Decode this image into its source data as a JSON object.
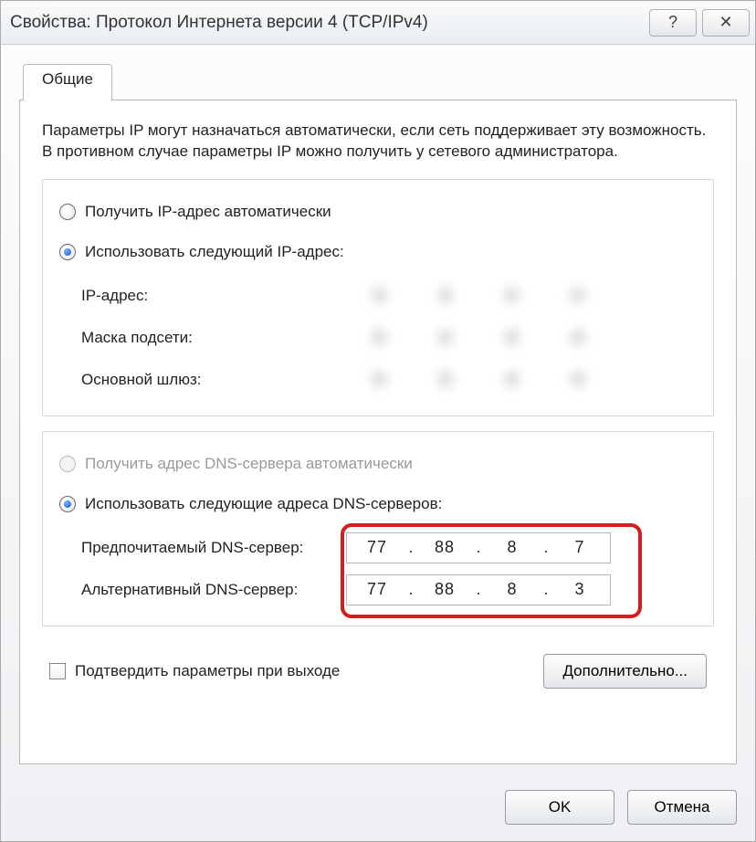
{
  "window": {
    "title": "Свойства: Протокол Интернета версии 4 (TCP/IPv4)"
  },
  "tabs": {
    "general": "Общие"
  },
  "description": "Параметры IP могут назначаться автоматически, если сеть поддерживает эту возможность. В противном случае параметры IP можно получить у сетевого администратора.",
  "ip_group": {
    "radio_auto": "Получить IP-адрес автоматически",
    "radio_manual": "Использовать следующий IP-адрес:",
    "field_ip": "IP-адрес:",
    "field_mask": "Маска подсети:",
    "field_gateway": "Основной шлюз:"
  },
  "dns_group": {
    "radio_auto": "Получить адрес DNS-сервера автоматически",
    "radio_manual": "Использовать следующие адреса DNS-серверов:",
    "field_preferred": "Предпочитаемый DNS-сервер:",
    "field_alternate": "Альтернативный DNS-сервер:",
    "preferred": {
      "a": "77",
      "b": "88",
      "c": "8",
      "d": "7"
    },
    "alternate": {
      "a": "77",
      "b": "88",
      "c": "8",
      "d": "3"
    }
  },
  "validate_checkbox": "Подтвердить параметры при выходе",
  "buttons": {
    "advanced": "Дополнительно...",
    "ok": "OK",
    "cancel": "Отмена"
  }
}
